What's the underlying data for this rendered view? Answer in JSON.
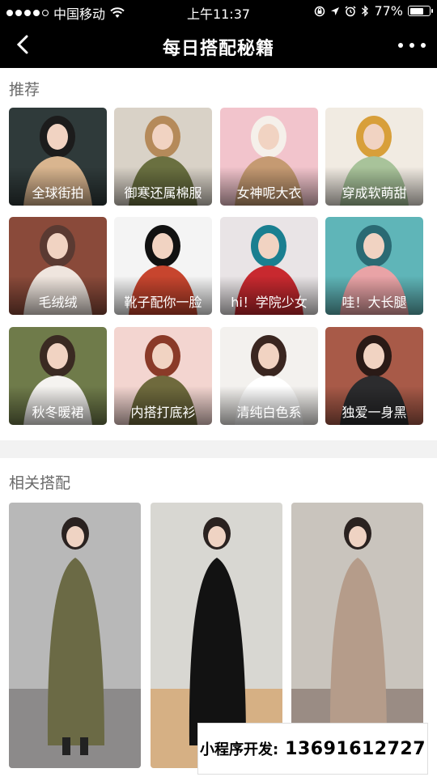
{
  "status_bar": {
    "carrier": "中国移动",
    "time": "上午11:37",
    "battery_text": "77%",
    "battery_level": 0.77,
    "signal_bars_filled": 4,
    "signal_bars_total": 5,
    "icons": [
      "wifi-icon",
      "orientation-lock-icon",
      "location-icon",
      "alarm-icon",
      "bluetooth-icon",
      "battery-icon"
    ]
  },
  "nav": {
    "title": "每日搭配秘籍",
    "back_icon": "chevron-left-icon",
    "more_icon": "more-dots-icon"
  },
  "recommend": {
    "title": "推荐",
    "items": [
      {
        "label": "全球街拍",
        "colors": [
          "#2f3a3a",
          "#d9b58f",
          "#1c1c1c"
        ]
      },
      {
        "label": "御寒还属棉服",
        "colors": [
          "#d9d2c7",
          "#6a7040",
          "#b58a5a"
        ]
      },
      {
        "label": "女神呢大衣",
        "colors": [
          "#f2c4cc",
          "#c59a72",
          "#f5f0ea"
        ]
      },
      {
        "label": "穿成软萌甜",
        "colors": [
          "#f1ebe2",
          "#a8c39a",
          "#d89f3a"
        ]
      },
      {
        "label": "毛绒绒",
        "colors": [
          "#8a4a3a",
          "#efe5de",
          "#5a3a32"
        ]
      },
      {
        "label": "靴子配你一脸",
        "colors": [
          "#f4f4f4",
          "#c7452e",
          "#111111"
        ]
      },
      {
        "label": "hi！学院少女",
        "colors": [
          "#e9e4e6",
          "#c8292f",
          "#1a7f90"
        ]
      },
      {
        "label": "哇！大长腿",
        "colors": [
          "#5fb5b8",
          "#e9a3a6",
          "#2a6a73"
        ]
      },
      {
        "label": "秋冬暖裙",
        "colors": [
          "#6f7b4a",
          "#f5f3f0",
          "#3a2a22"
        ]
      },
      {
        "label": "内搭打底衫",
        "colors": [
          "#f3d5d0",
          "#6f6a3d",
          "#8a3a28"
        ]
      },
      {
        "label": "清纯白色系",
        "colors": [
          "#f3f1ee",
          "#ffffff",
          "#3a2620"
        ]
      },
      {
        "label": "独爱一身黑",
        "colors": [
          "#a85a48",
          "#2c2c2e",
          "#2a1a16"
        ]
      }
    ]
  },
  "related": {
    "title": "相关搭配",
    "photos": [
      {
        "colors": [
          "#b8b8b8",
          "#6b6a45",
          "#8c8a8a"
        ]
      },
      {
        "colors": [
          "#d8d7d2",
          "#121212",
          "#d6b084"
        ]
      },
      {
        "colors": [
          "#c9c4bd",
          "#b59c8a",
          "#9a8c84"
        ]
      }
    ]
  },
  "watermark": {
    "label": "小程序开发:",
    "phone": "13691612727"
  }
}
